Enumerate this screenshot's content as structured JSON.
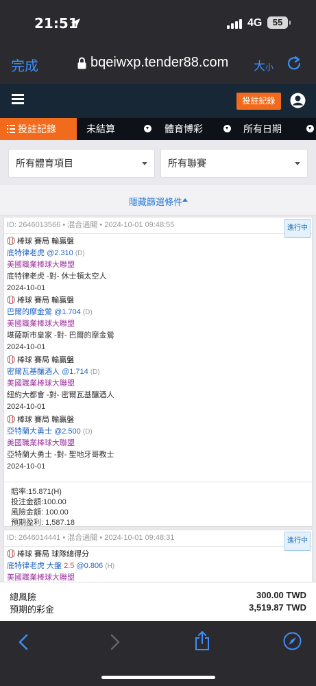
{
  "status_bar": {
    "time": "21:51",
    "network": "4G",
    "battery": "55"
  },
  "browser": {
    "done_label": "完成",
    "url": "bqeiwxp.tender88.com",
    "text_size_label": "大",
    "text_size_small": "小"
  },
  "header": {
    "bet_record_button": "投註記錄"
  },
  "tabs": {
    "active": "投註記錄",
    "unsettled": "未結算",
    "sports": "體育博彩",
    "dates": "所有日期"
  },
  "filters": {
    "sport_select": "所有體育項目",
    "league_select": "所有聯賽",
    "hide_filter": "隱藏篩選條件"
  },
  "bets": [
    {
      "meta": "ID: 2646013566 • 混合過關 • 2024-10-01 09:48:55",
      "status": "進行中",
      "legs": [
        {
          "market": "棒球 賽局 輸贏盤",
          "selection": "底特律老虎",
          "odds": "@2.310",
          "tag": "(D)",
          "league": "美國職業棒球大聯盟",
          "teams": "底特律老虎 -對- 休士頓太空人",
          "date": "2024-10-01"
        },
        {
          "market": "棒球 賽局 輸贏盤",
          "selection": "巴爾的摩金鶯",
          "odds": "@1.704",
          "tag": "(D)",
          "league": "美國職業棒球大聯盟",
          "teams": "堪薩斯市皇家 -對- 巴爾的摩金鶯",
          "date": "2024-10-01"
        },
        {
          "market": "棒球 賽局 輸贏盤",
          "selection": "密爾瓦基釀酒人",
          "odds": "@1.714",
          "tag": "(D)",
          "league": "美國職業棒球大聯盟",
          "teams": "紐約大都會 -對- 密爾瓦基釀酒人",
          "date": "2024-10-01"
        },
        {
          "market": "棒球 賽局 輸贏盤",
          "selection": "亞特蘭大勇士",
          "odds": "@2.500",
          "tag": "(D)",
          "league": "美國職業棒球大聯盟",
          "teams": "亞特蘭大勇士 -對- 聖地牙哥教士",
          "date": "2024-10-01"
        }
      ],
      "summary": {
        "odds": "賠率:15.871(H)",
        "stake": "投注金額:100.00",
        "risk": "風險金額: 100.00",
        "profit": "預期盈利: 1,587.18"
      }
    },
    {
      "meta": "ID: 2646014441 • 混合過關 • 2024-10-01 09:48:31",
      "status": "進行中",
      "legs": [
        {
          "market": "棒球 賽局 球隊總得分",
          "selection": "底特律老虎 大盤",
          "handicap": "2.5",
          "odds": "@0.806",
          "tag": "(H)",
          "league": "美國職業棒球大聯盟"
        }
      ]
    }
  ],
  "totals": {
    "risk_label": "總風險",
    "risk_value": "300.00 TWD",
    "payout_label": "預期的彩金",
    "payout_value": "3,519.87 TWD"
  }
}
